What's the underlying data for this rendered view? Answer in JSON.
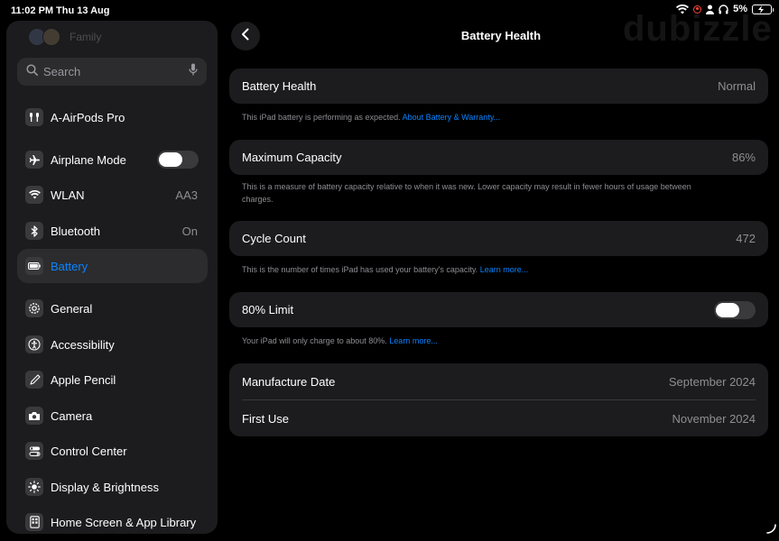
{
  "status_bar": {
    "time": "11:02 PM",
    "date": "Thu 13 Aug",
    "battery_percent": "5%",
    "icons": [
      "wifi-icon",
      "screen-recording-icon",
      "person-icon",
      "headphones-icon",
      "battery-charging-icon"
    ]
  },
  "watermark": "dubizzle",
  "sidebar": {
    "family_label": "Family",
    "search_placeholder": "Search",
    "items": [
      {
        "label": "A-AirPods Pro",
        "icon": "airpods-icon"
      },
      {
        "label": "Airplane Mode",
        "icon": "airplane-icon",
        "toggle": false
      },
      {
        "label": "WLAN",
        "icon": "wifi-icon",
        "value": "AA3"
      },
      {
        "label": "Bluetooth",
        "icon": "bluetooth-icon",
        "value": "On"
      },
      {
        "label": "Battery",
        "icon": "battery-icon",
        "selected": true
      },
      {
        "label": "General",
        "icon": "gear-icon"
      },
      {
        "label": "Accessibility",
        "icon": "accessibility-icon"
      },
      {
        "label": "Apple Pencil",
        "icon": "pencil-icon"
      },
      {
        "label": "Camera",
        "icon": "camera-icon"
      },
      {
        "label": "Control Center",
        "icon": "control-center-icon"
      },
      {
        "label": "Display & Brightness",
        "icon": "sun-icon"
      },
      {
        "label": "Home Screen & App Library",
        "icon": "home-screen-icon"
      }
    ]
  },
  "detail": {
    "title": "Battery Health",
    "health": {
      "label": "Battery Health",
      "value": "Normal",
      "note": "This iPad battery is performing as expected.",
      "link": "About Battery & Warranty..."
    },
    "capacity": {
      "label": "Maximum Capacity",
      "value": "86%",
      "note": "This is a measure of battery capacity relative to when it was new. Lower capacity may result in fewer hours of usage between charges."
    },
    "cycles": {
      "label": "Cycle Count",
      "value": "472",
      "note": "This is the number of times iPad has used your battery's capacity.",
      "link": "Learn more..."
    },
    "limit": {
      "label": "80% Limit",
      "enabled": false,
      "note": "Your iPad will only charge to about 80%.",
      "link": "Learn more..."
    },
    "dates": {
      "manufacture_label": "Manufacture Date",
      "manufacture_value": "September 2024",
      "first_use_label": "First Use",
      "first_use_value": "November 2024"
    }
  },
  "colors": {
    "background": "#000000",
    "card": "#1c1c1e",
    "accent": "#0a84ff",
    "secondary_text": "#8e8e93"
  }
}
